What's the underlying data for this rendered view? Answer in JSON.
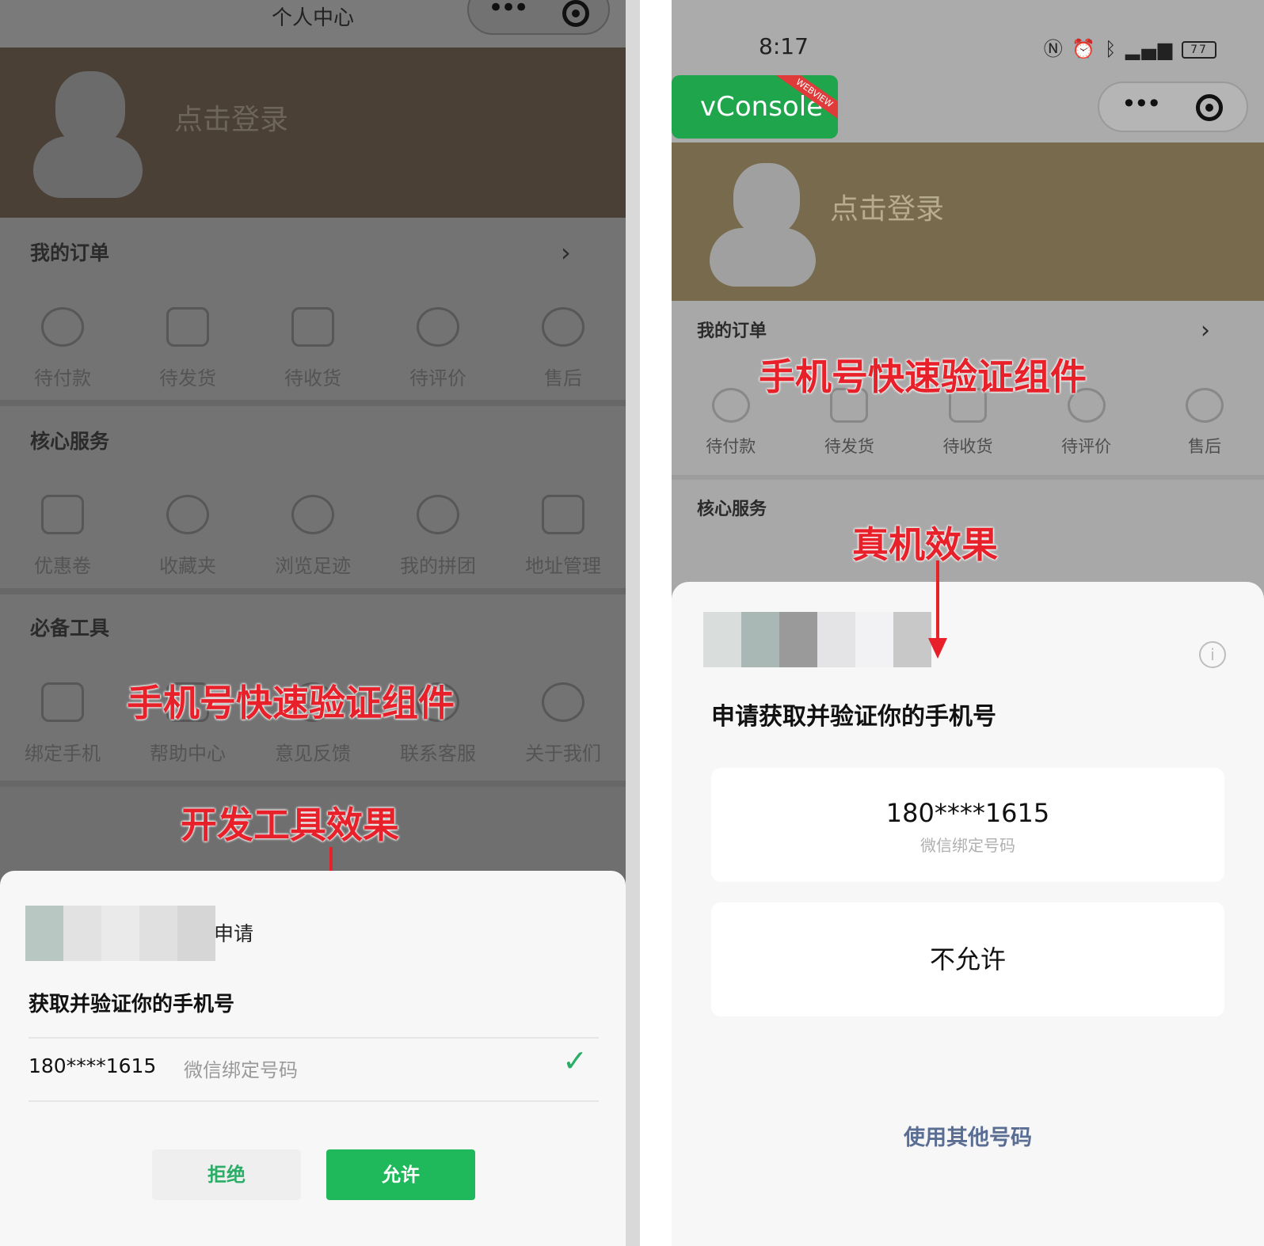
{
  "left": {
    "nav_title": "个人中心",
    "header": {
      "login_text": "点击登录"
    },
    "orders": {
      "title": "我的订单",
      "items": [
        "待付款",
        "待发货",
        "待收货",
        "待评价",
        "售后"
      ]
    },
    "core": {
      "title": "核心服务",
      "items": [
        "优惠卷",
        "收藏夹",
        "浏览足迹",
        "我的拼团",
        "地址管理"
      ]
    },
    "tools": {
      "title": "必备工具",
      "items": [
        "绑定手机",
        "帮助中心",
        "意见反馈",
        "联系客服",
        "关于我们"
      ]
    },
    "annotation_component": "手机号快速验证组件",
    "annotation_effect": "开发工具效果",
    "sheet": {
      "apply": "申请",
      "title": "获取并验证你的手机号",
      "phone": "180****1615",
      "bind_label": "微信绑定号码",
      "reject": "拒绝",
      "allow": "允许"
    }
  },
  "right": {
    "status": {
      "time": "8:17",
      "battery": "77"
    },
    "vconsole": {
      "label": "vConsole",
      "ribbon": "WEBVIEW"
    },
    "header": {
      "login_text": "点击登录"
    },
    "orders": {
      "title": "我的订单",
      "items": [
        "待付款",
        "待发货",
        "待收货",
        "待评价",
        "售后"
      ]
    },
    "core": {
      "title": "核心服务"
    },
    "annotation_component": "手机号快速验证组件",
    "annotation_effect": "真机效果",
    "sheet": {
      "title": "申请获取并验证你的手机号",
      "phone": "180****1615",
      "bind_label": "微信绑定号码",
      "deny": "不允许",
      "other": "使用其他号码"
    }
  },
  "colors": {
    "wechat_green": "#1fb85b",
    "annotation_red": "#e8202a",
    "link_blue": "#5a6e93"
  }
}
